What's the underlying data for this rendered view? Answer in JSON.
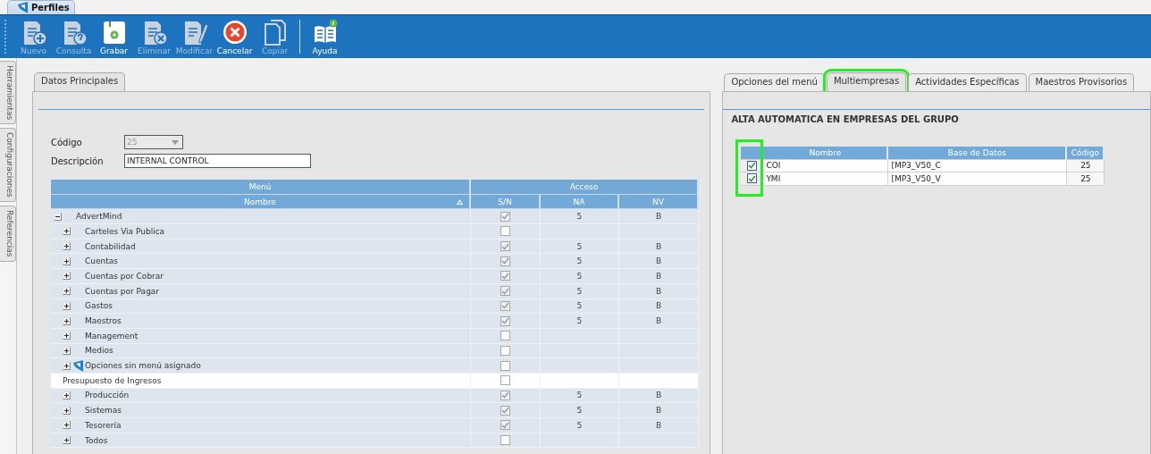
{
  "window": {
    "tab": "Perfiles"
  },
  "toolbar": [
    {
      "label": "Nuevo",
      "kind": "new",
      "disabled": true
    },
    {
      "label": "Consulta",
      "kind": "query",
      "disabled": true
    },
    {
      "label": "Grabar",
      "kind": "save",
      "disabled": false
    },
    {
      "label": "Eliminar",
      "kind": "delete",
      "disabled": true
    },
    {
      "label": "Modificar",
      "kind": "edit",
      "disabled": true
    },
    {
      "label": "Cancelar",
      "kind": "cancel",
      "disabled": false
    },
    {
      "label": "Copiar",
      "kind": "copy",
      "disabled": true
    },
    {
      "label": "Ayuda",
      "kind": "help",
      "disabled": false,
      "separator_before": true
    }
  ],
  "side_tabs": [
    "Herramientas",
    "Configuraciones",
    "Referencias"
  ],
  "left_tabs": [
    {
      "label": "Datos Principales",
      "selected": true
    }
  ],
  "form": {
    "codigo": {
      "label": "Código",
      "value": "25",
      "disabled": true
    },
    "descripcion": {
      "label": "Descripción",
      "value": "INTERNAL CONTROL"
    }
  },
  "menu_grid": {
    "group_headers": [
      "Menú",
      "Acceso"
    ],
    "columns": [
      "Nombre",
      "S/N",
      "NA",
      "NV"
    ],
    "rows": [
      {
        "name": "AdvertMind",
        "kind": "folder",
        "expanded": true,
        "checked": true,
        "na": "5",
        "nv": "B",
        "children": [
          {
            "name": "Carteles Via Publica",
            "kind": "folder",
            "expanded": false,
            "checked": false
          },
          {
            "name": "Contabilidad",
            "kind": "folder",
            "expanded": false,
            "checked": true,
            "na": "5",
            "nv": "B"
          },
          {
            "name": "Cuentas",
            "kind": "folder",
            "expanded": false,
            "checked": true,
            "na": "5",
            "nv": "B"
          },
          {
            "name": "Cuentas por Cobrar",
            "kind": "folder",
            "expanded": false,
            "checked": true,
            "na": "5",
            "nv": "B"
          },
          {
            "name": "Cuentas por Pagar",
            "kind": "folder",
            "expanded": false,
            "checked": true,
            "na": "5",
            "nv": "B"
          },
          {
            "name": "Gastos",
            "kind": "folder",
            "expanded": false,
            "checked": true,
            "na": "5",
            "nv": "B"
          },
          {
            "name": "Maestros",
            "kind": "folder",
            "expanded": false,
            "checked": true,
            "na": "5",
            "nv": "B"
          },
          {
            "name": "Management",
            "kind": "folder",
            "expanded": false,
            "checked": false
          },
          {
            "name": "Medios",
            "kind": "folder",
            "expanded": false,
            "checked": false
          },
          {
            "name": "Opciones sin menú asignado",
            "kind": "app",
            "expanded": false,
            "checked": false
          },
          {
            "name": "Presupuesto de Ingresos",
            "kind": "item",
            "selected": true,
            "checked": false
          },
          {
            "name": "Producción",
            "kind": "folder",
            "expanded": false,
            "checked": true,
            "na": "5",
            "nv": "B"
          },
          {
            "name": "Sistemas",
            "kind": "folder",
            "expanded": false,
            "checked": true,
            "na": "5",
            "nv": "B"
          },
          {
            "name": "Tesorería",
            "kind": "folder",
            "expanded": false,
            "checked": true,
            "na": "5",
            "nv": "B"
          },
          {
            "name": "Todos",
            "kind": "folder",
            "expanded": false,
            "checked": false
          }
        ]
      }
    ]
  },
  "right_tabs": [
    {
      "label": "Opciones del menú",
      "selected": false,
      "highlighted": false
    },
    {
      "label": "Multiempresas",
      "selected": true,
      "highlighted": true
    },
    {
      "label": "Actividades Específicas",
      "selected": false,
      "highlighted": false
    },
    {
      "label": "Maestros Provisorios",
      "selected": false,
      "highlighted": false
    }
  ],
  "section_title": "ALTA AUTOMATICA EN EMPRESAS DEL GRUPO",
  "companies": {
    "check_column_highlighted": true,
    "columns": [
      "Nombre",
      "Base de Datos",
      "Código"
    ],
    "rows": [
      {
        "checked": true,
        "nombre": "COI",
        "base": "[MP3_V50_C",
        "codigo": "25"
      },
      {
        "checked": true,
        "nombre": "YMI",
        "base": "[MP3_V50_V",
        "codigo": "25"
      }
    ]
  }
}
